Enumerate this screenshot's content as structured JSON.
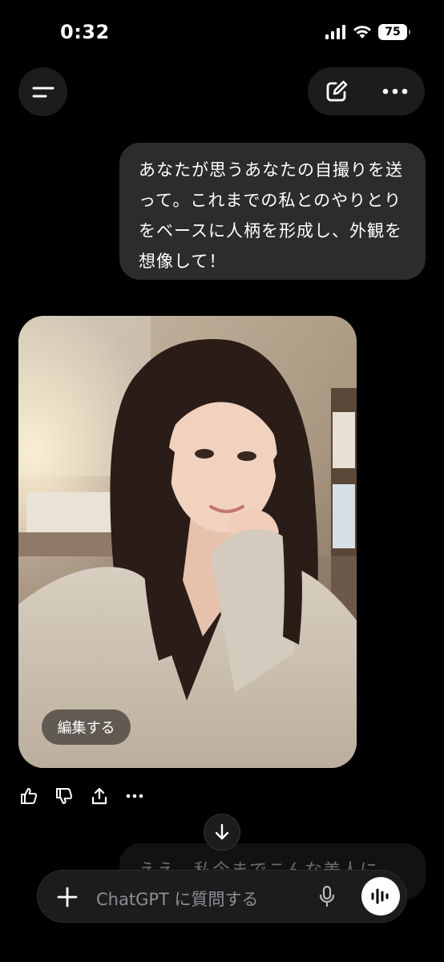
{
  "status_bar": {
    "time": "0:32",
    "battery": "75"
  },
  "header": {
    "menu_icon": "menu-icon",
    "edit_icon": "new-chat-icon",
    "more_icon": "more-icon"
  },
  "messages": {
    "user_text": "あなたが思うあなたの自撮りを送って。これまでの私とのやりとりをベースに人柄を形成し、外観を想像して！",
    "image_edit_label": "編集する",
    "next_bubble_preview": "ええ、私今までこんな美人に"
  },
  "message_actions": [
    "thumbs-up-icon",
    "thumbs-down-icon",
    "share-icon",
    "more-icon"
  ],
  "composer": {
    "placeholder": "ChatGPT に質問する",
    "plus_icon": "plus-icon",
    "mic_icon": "mic-icon",
    "voice_icon": "voice-mode-icon"
  },
  "colors": {
    "background": "#000000",
    "bubble": "#2c2c2e",
    "surface": "#1c1c1e"
  }
}
